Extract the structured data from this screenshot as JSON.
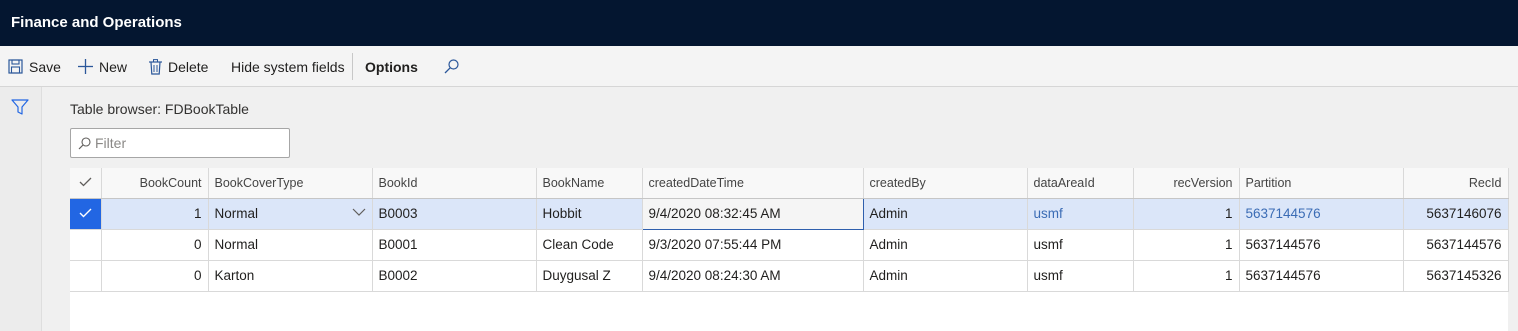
{
  "app": {
    "title": "Finance and Operations"
  },
  "toolbar": {
    "save": "Save",
    "new": "New",
    "delete": "Delete",
    "hide_system_fields": "Hide system fields",
    "options": "Options"
  },
  "page": {
    "caption": "Table browser: FDBookTable",
    "filter_placeholder": "Filter"
  },
  "grid": {
    "columns": [
      "BookCount",
      "BookCoverType",
      "BookId",
      "BookName",
      "createdDateTime",
      "createdBy",
      "dataAreaId",
      "recVersion",
      "Partition",
      "RecId"
    ],
    "rows": [
      {
        "selected": true,
        "cells": [
          "1",
          "Normal",
          "B0003",
          "Hobbit",
          "9/4/2020 08:32:45 AM",
          "Admin",
          "usmf",
          "1",
          "5637144576",
          "5637146076"
        ]
      },
      {
        "selected": false,
        "cells": [
          "0",
          "Normal",
          "B0001",
          "Clean Code",
          "9/3/2020 07:55:44 PM",
          "Admin",
          "usmf",
          "1",
          "5637144576",
          "5637144576"
        ]
      },
      {
        "selected": false,
        "cells": [
          "0",
          "Karton",
          "B0002",
          "Duygusal Z",
          "9/4/2020 08:24:30 AM",
          "Admin",
          "usmf",
          "1",
          "5637144576",
          "5637145326"
        ]
      }
    ]
  },
  "colors": {
    "topbar": "#041630",
    "selection": "#2266e3",
    "selected_row": "#dbe6f9",
    "link": "#3b6cb5"
  },
  "icons": [
    "save-icon",
    "plus-icon",
    "trash-icon",
    "search-icon",
    "funnel-icon",
    "checkmark-icon",
    "chevron-down-icon"
  ]
}
